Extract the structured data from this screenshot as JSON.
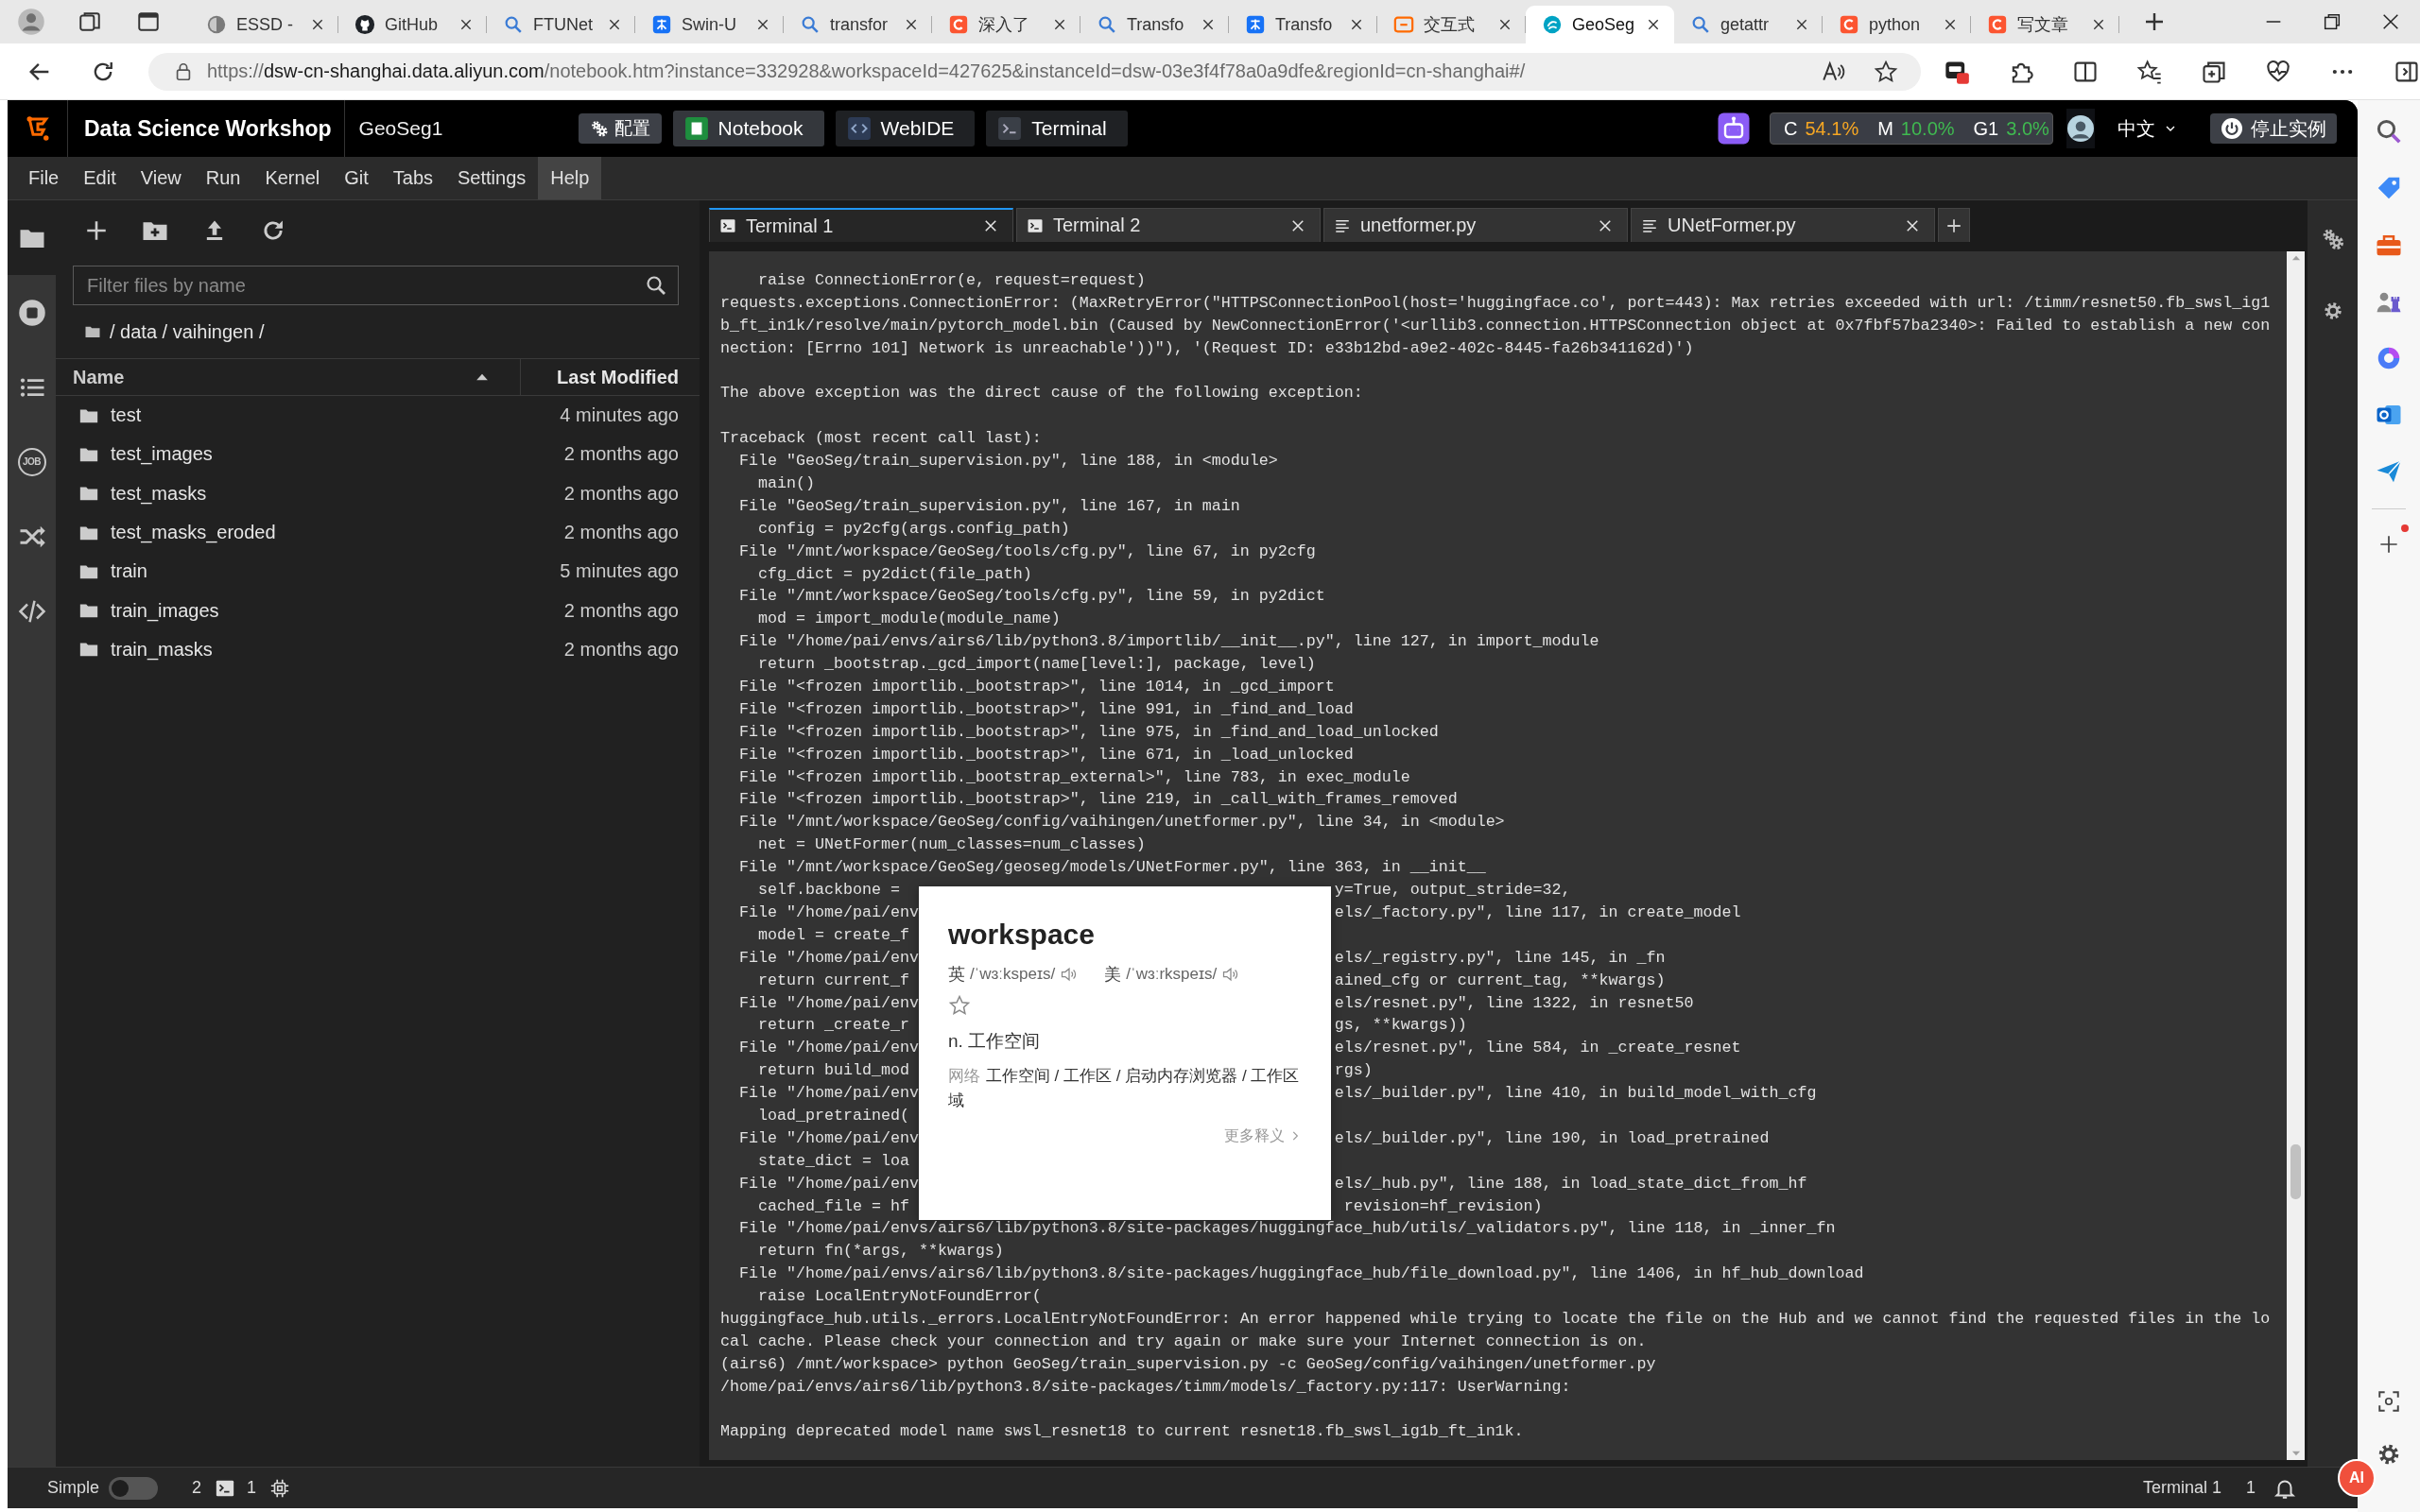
{
  "browser": {
    "tabs": [
      {
        "title": "ESSD -",
        "kind": "page",
        "selected": false
      },
      {
        "title": "GitHub",
        "kind": "github",
        "selected": false
      },
      {
        "title": "FTUNet",
        "kind": "search",
        "selected": false
      },
      {
        "title": "Swin-U",
        "kind": "zhihu",
        "selected": false
      },
      {
        "title": "transfor",
        "kind": "search",
        "selected": false
      },
      {
        "title": "深入了",
        "kind": "csdn",
        "selected": false
      },
      {
        "title": "Transfo",
        "kind": "search",
        "selected": false
      },
      {
        "title": "Transfo",
        "kind": "zhihu",
        "selected": false
      },
      {
        "title": "交互式",
        "kind": "bracket",
        "selected": false
      },
      {
        "title": "GeoSeg",
        "kind": "geo",
        "selected": true
      },
      {
        "title": "getattr",
        "kind": "search",
        "selected": false
      },
      {
        "title": "python",
        "kind": "csdn",
        "selected": false
      },
      {
        "title": "写文章",
        "kind": "csdn",
        "selected": false
      }
    ],
    "url": {
      "scheme": "https://",
      "host": "dsw-cn-shanghai.data.aliyun.com",
      "path": "/notebook.htm?instance=332928&workspaceId=427625&instanceId=dsw-03e3f4f78a0a9dfe&regionId=cn-shanghai#/"
    }
  },
  "header": {
    "brand": "Data Science Workshop",
    "project": "GeoSeg1",
    "config_button": "配置",
    "nav": [
      {
        "label": "Notebook",
        "kind": "notebook",
        "selected": true
      },
      {
        "label": "WebIDE",
        "kind": "webide",
        "selected": false
      },
      {
        "label": "Terminal",
        "kind": "terminal",
        "selected": false
      }
    ],
    "metrics": [
      {
        "label": "C",
        "value": "54.1%",
        "color": "#f5a623"
      },
      {
        "label": "M",
        "value": "10.0%",
        "color": "#3fb950"
      },
      {
        "label": "G1",
        "value": "3.0%",
        "color": "#3fb950"
      }
    ],
    "language": "中文",
    "stop_button": "停止实例"
  },
  "menu": [
    {
      "label": "File",
      "selected": false
    },
    {
      "label": "Edit",
      "selected": false
    },
    {
      "label": "View",
      "selected": false
    },
    {
      "label": "Run",
      "selected": false
    },
    {
      "label": "Kernel",
      "selected": false
    },
    {
      "label": "Git",
      "selected": false
    },
    {
      "label": "Tabs",
      "selected": false
    },
    {
      "label": "Settings",
      "selected": false
    },
    {
      "label": "Help",
      "selected": true
    }
  ],
  "activity_bar": [
    {
      "kind": "folder",
      "selected": true
    },
    {
      "kind": "running",
      "selected": false
    },
    {
      "kind": "toc",
      "selected": false
    },
    {
      "kind": "job",
      "label": "JOB",
      "selected": false
    },
    {
      "kind": "shuffle",
      "selected": false
    },
    {
      "kind": "code",
      "selected": false
    }
  ],
  "file_browser": {
    "filter_placeholder": "Filter files by name",
    "breadcrumb": "/ data / vaihingen /",
    "columns": [
      {
        "label": "Name",
        "sorted": true
      },
      {
        "label": "Last Modified",
        "sorted": false
      }
    ],
    "rows": [
      {
        "name": "test",
        "modified": "4 minutes ago"
      },
      {
        "name": "test_images",
        "modified": "2 months ago"
      },
      {
        "name": "test_masks",
        "modified": "2 months ago"
      },
      {
        "name": "test_masks_eroded",
        "modified": "2 months ago"
      },
      {
        "name": "train",
        "modified": "5 minutes ago"
      },
      {
        "name": "train_images",
        "modified": "2 months ago"
      },
      {
        "name": "train_masks",
        "modified": "2 months ago"
      }
    ]
  },
  "editor": {
    "tabs": [
      {
        "label": "Terminal 1",
        "kind": "terminal",
        "selected": true
      },
      {
        "label": "Terminal 2",
        "kind": "terminal",
        "selected": false
      },
      {
        "label": "unetformer.py",
        "kind": "file",
        "selected": false
      },
      {
        "label": "UNetFormer.py",
        "kind": "file",
        "selected": false
      }
    ],
    "terminal": {
      "lines": [
        {
          "kind": "text",
          "text": "    raise ConnectionError(e, request=request)"
        },
        {
          "kind": "text",
          "text": "requests.exceptions.ConnectionError: (MaxRetryError(\"HTTPSConnectionPool(host='huggingface.co', port=443): Max retries exceeded with url: /timm/resnet50.fb_swsl_ig1"
        },
        {
          "kind": "text",
          "text": "b_ft_in1k/resolve/main/pytorch_model.bin (Caused by NewConnectionError('<urllib3.connection.HTTPSConnection object at 0x7fbf57ba2340>: Failed to establish a new con"
        },
        {
          "kind": "text",
          "text": "nection: [Errno 101] Network is unreachable'))\"), '(Request ID: e33b12bd-a9e2-402c-8445-fa26b341162d)')"
        },
        {
          "kind": "blank"
        },
        {
          "kind": "text",
          "text": "The above exception was the direct cause of the following exception:"
        },
        {
          "kind": "blank"
        },
        {
          "kind": "text",
          "text": "Traceback (most recent call last):"
        },
        {
          "kind": "text",
          "text": "  File \"GeoSeg/train_supervision.py\", line 188, in <module>"
        },
        {
          "kind": "text",
          "text": "    main()"
        },
        {
          "kind": "text",
          "text": "  File \"GeoSeg/train_supervision.py\", line 167, in main"
        },
        {
          "kind": "text",
          "text": "    config = py2cfg(args.config_path)"
        },
        {
          "kind": "text",
          "text": "  File \"/mnt/workspace/GeoSeg/tools/cfg.py\", line 67, in py2cfg"
        },
        {
          "kind": "text",
          "text": "    cfg_dict = py2dict(file_path)"
        },
        {
          "kind": "text",
          "text": "  File \"/mnt/workspace/GeoSeg/tools/cfg.py\", line 59, in py2dict"
        },
        {
          "kind": "text",
          "text": "    mod = import_module(module_name)"
        },
        {
          "kind": "text",
          "text": "  File \"/home/pai/envs/airs6/lib/python3.8/importlib/__init__.py\", line 127, in import_module"
        },
        {
          "kind": "text",
          "text": "    return _bootstrap._gcd_import(name[level:], package, level)"
        },
        {
          "kind": "text",
          "text": "  File \"<frozen importlib._bootstrap>\", line 1014, in _gcd_import"
        },
        {
          "kind": "text",
          "text": "  File \"<frozen importlib._bootstrap>\", line 991, in _find_and_load"
        },
        {
          "kind": "text",
          "text": "  File \"<frozen importlib._bootstrap>\", line 975, in _find_and_load_unlocked"
        },
        {
          "kind": "text",
          "text": "  File \"<frozen importlib._bootstrap>\", line 671, in _load_unlocked"
        },
        {
          "kind": "text",
          "text": "  File \"<frozen importlib._bootstrap_external>\", line 783, in exec_module"
        },
        {
          "kind": "text",
          "text": "  File \"<frozen importlib._bootstrap>\", line 219, in _call_with_frames_removed"
        },
        {
          "kind": "text",
          "text": "  File \"/mnt/workspace/GeoSeg/config/vaihingen/unetformer.py\", line 34, in <module>"
        },
        {
          "kind": "text",
          "text": "    net = UNetFormer(num_classes=num_classes)"
        },
        {
          "kind": "text",
          "text": "  File \"/mnt/workspace/GeoSeg/geoseg/models/UNetFormer.py\", line 363, in __init__"
        },
        {
          "kind": "covered",
          "left": "    self.backbone = ",
          "right": "y=True, output_stride=32,"
        },
        {
          "kind": "covered",
          "left": "  File \"/home/pai/env",
          "right": "els/_factory.py\", line 117, in create_model"
        },
        {
          "kind": "covered",
          "left": "    model = create_f"
        },
        {
          "kind": "covered",
          "left": "  File \"/home/pai/env",
          "right": "els/_registry.py\", line 145, in _fn"
        },
        {
          "kind": "covered",
          "left": "    return current_f",
          "right": "ained_cfg or current_tag, **kwargs)"
        },
        {
          "kind": "covered",
          "left": "  File \"/home/pai/env",
          "right": "els/resnet.py\", line 1322, in resnet50"
        },
        {
          "kind": "covered",
          "left": "    return _create_r",
          "right": "gs, **kwargs))"
        },
        {
          "kind": "covered",
          "left": "  File \"/home/pai/env",
          "right": "els/resnet.py\", line 584, in _create_resnet"
        },
        {
          "kind": "covered",
          "left": "    return build_mod",
          "right": "rgs)"
        },
        {
          "kind": "covered",
          "left": "  File \"/home/pai/env",
          "right": "els/_builder.py\", line 410, in build_model_with_cfg"
        },
        {
          "kind": "covered",
          "left": "    load_pretrained("
        },
        {
          "kind": "covered",
          "left": "  File \"/home/pai/env",
          "right": "els/_builder.py\", line 190, in load_pretrained"
        },
        {
          "kind": "covered",
          "left": "    state_dict = loa"
        },
        {
          "kind": "covered",
          "left": "  File \"/home/pai/env",
          "right": "els/_hub.py\", line 188, in load_state_dict_from_hf"
        },
        {
          "kind": "covered",
          "left": "    cached_file = hf",
          "right": " revision=hf_revision)"
        },
        {
          "kind": "text",
          "text": "  File \"/home/pai/envs/airs6/lib/python3.8/site-packages/huggingface_hub/utils/_validators.py\", line 118, in _inner_fn"
        },
        {
          "kind": "text",
          "text": "    return fn(*args, **kwargs)"
        },
        {
          "kind": "text",
          "text": "  File \"/home/pai/envs/airs6/lib/python3.8/site-packages/huggingface_hub/file_download.py\", line 1406, in hf_hub_download"
        },
        {
          "kind": "text",
          "text": "    raise LocalEntryNotFoundError("
        },
        {
          "kind": "text",
          "text": "huggingface_hub.utils._errors.LocalEntryNotFoundError: An error happened while trying to locate the file on the Hub and we cannot find the requested files in the lo"
        },
        {
          "kind": "text",
          "text": "cal cache. Please check your connection and try again or make sure your Internet connection is on."
        },
        {
          "kind": "text",
          "text": "(airs6) /mnt/workspace> python GeoSeg/train_supervision.py -c GeoSeg/config/vaihingen/unetformer.py"
        },
        {
          "kind": "text",
          "text": "/home/pai/envs/airs6/lib/python3.8/site-packages/timm/models/_factory.py:117: UserWarning:"
        },
        {
          "kind": "blank"
        },
        {
          "kind": "text",
          "text": "Mapping deprecated model name swsl_resnet18 to current resnet18.fb_swsl_ig1b_ft_in1k."
        }
      ]
    },
    "popup": {
      "word": "workspace",
      "pronunciations": [
        {
          "label": "英",
          "phonetic": "/ˈwɜːkspeɪs/"
        },
        {
          "label": "美",
          "phonetic": "/ˈwɜːrkspeɪs/"
        }
      ],
      "definition": "n. 工作空间",
      "web_label": "网络",
      "web_text": "工作空间 / 工作区 / 启动内存浏览器 / 工作区域",
      "more": "更多释义"
    }
  },
  "status_bar": {
    "mode_label": "Simple",
    "mode_on": false,
    "terminals": "2",
    "kernels": "1",
    "current": "Terminal 1",
    "line": "1"
  },
  "floating_button": {
    "label": "AI"
  }
}
